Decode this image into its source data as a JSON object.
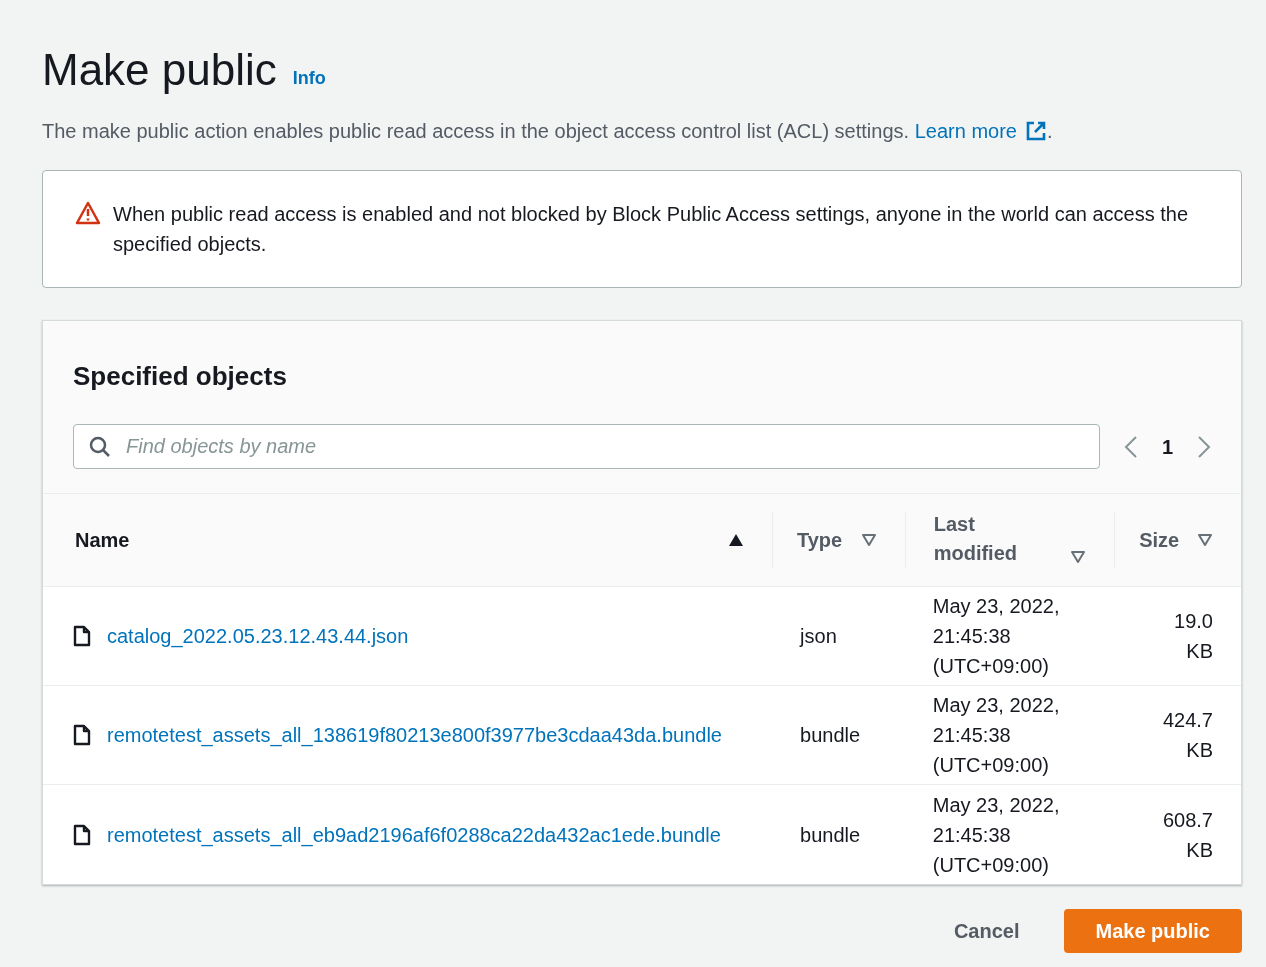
{
  "header": {
    "title": "Make public",
    "info_link": "Info",
    "description": "The make public action enables public read access in the object access control list (ACL) settings.",
    "learn_more": "Learn more",
    "description_end": "."
  },
  "alert": {
    "kind": "warning",
    "text": "When public read access is enabled and not blocked by Block Public Access settings, anyone in the world can access the specified objects."
  },
  "objects": {
    "title": "Specified objects",
    "search": {
      "placeholder": "Find objects by name"
    },
    "pagination": {
      "pages": [
        {
          "label": "1",
          "selected": true
        }
      ]
    },
    "columns": [
      {
        "label": "Name",
        "sorted": true
      },
      {
        "label": "Type",
        "sorted": false
      },
      {
        "label": "Last modified",
        "sorted": false
      },
      {
        "label": "Size",
        "sorted": false
      }
    ],
    "rows": [
      {
        "name": "catalog_2022.05.23.12.43.44.json",
        "type": "json",
        "last_modified": "May 23, 2022, 21:45:38 (UTC+09:00)",
        "size": "19.0 KB"
      },
      {
        "name": "remotetest_assets_all_138619f80213e800f3977be3cdaa43da.bundle",
        "type": "bundle",
        "last_modified": "May 23, 2022, 21:45:38 (UTC+09:00)",
        "size": "424.7 KB"
      },
      {
        "name": "remotetest_assets_all_eb9ad2196af6f0288ca22da432ac1ede.bundle",
        "type": "bundle",
        "last_modified": "May 23, 2022, 21:45:38 (UTC+09:00)",
        "size": "608.7 KB"
      }
    ]
  },
  "buttons": [
    {
      "label": "Cancel",
      "kind": "secondary"
    },
    {
      "label": "Make public",
      "kind": "primary"
    }
  ]
}
